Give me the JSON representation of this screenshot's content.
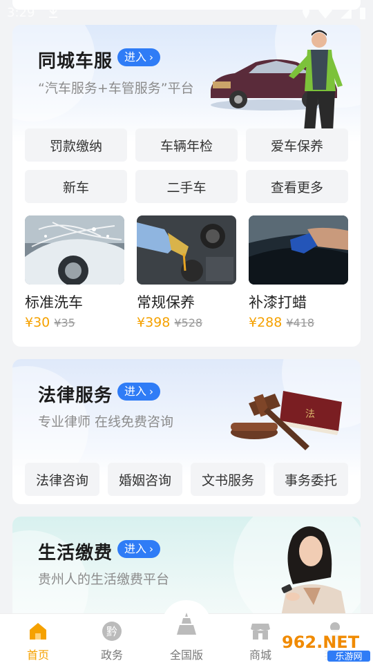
{
  "status": {
    "time": "3:29"
  },
  "car": {
    "title": "同城车服",
    "enter_label": "进入",
    "subtitle": "“汽车服务+车管服务”平台",
    "quick": [
      "罚款缴纳",
      "车辆年检",
      "爱车保养",
      "新车",
      "二手车",
      "查看更多"
    ],
    "services": [
      {
        "name": "标准洗车",
        "price": "¥30",
        "orig": "¥35"
      },
      {
        "name": "常规保养",
        "price": "¥398",
        "orig": "¥528"
      },
      {
        "name": "补漆打蜡",
        "price": "¥288",
        "orig": "¥418"
      }
    ]
  },
  "law": {
    "title": "法律服务",
    "enter_label": "进入",
    "subtitle": "专业律师 在线免费咨询",
    "book_text": "法",
    "buttons": [
      "法律咨询",
      "婚姻咨询",
      "文书服务",
      "事务委托"
    ]
  },
  "life": {
    "title": "生活缴费",
    "enter_label": "进入",
    "subtitle": "贵州人的生活缴费平台"
  },
  "tabbar": {
    "items": [
      {
        "label": "首页",
        "active": true
      },
      {
        "label": "政务",
        "icon_text": "黔"
      },
      {
        "label": "全国版"
      },
      {
        "label": "商城"
      },
      {
        "label": "我的"
      }
    ]
  },
  "watermark": {
    "text": "962.NET",
    "sub": "乐游网"
  },
  "colors": {
    "accent": "#f5a100",
    "enter_blue": "#2f7cf6"
  }
}
